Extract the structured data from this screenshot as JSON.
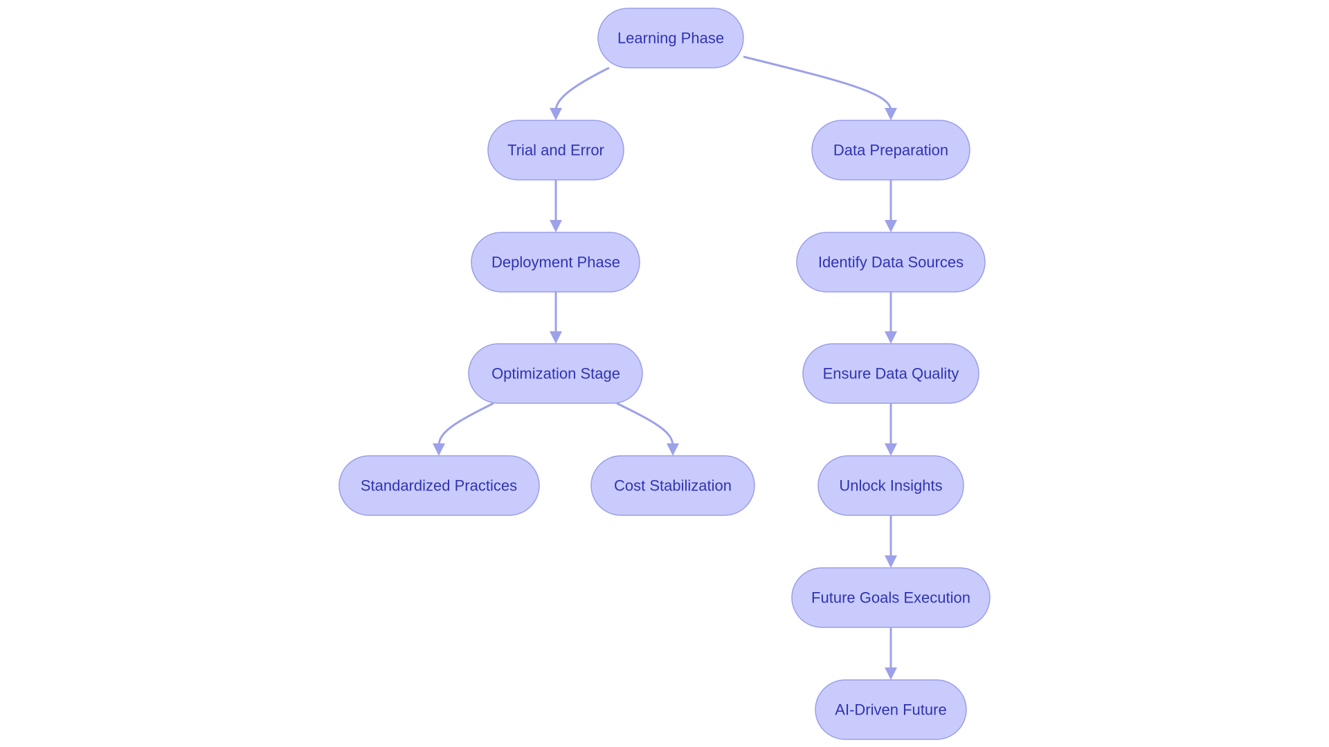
{
  "diagram": {
    "type": "flowchart",
    "colors": {
      "node_fill": "#c9cbfd",
      "node_border": "#9a9ee6",
      "text": "#3033b0",
      "edge": "#9da1e8"
    },
    "nodes": {
      "learning_phase": "Learning Phase",
      "trial_and_error": "Trial and Error",
      "data_preparation": "Data Preparation",
      "deployment_phase": "Deployment Phase",
      "identify_data_sources": "Identify Data Sources",
      "optimization_stage": "Optimization Stage",
      "ensure_data_quality": "Ensure Data Quality",
      "standardized_practices": "Standardized Practices",
      "cost_stabilization": "Cost Stabilization",
      "unlock_insights": "Unlock Insights",
      "future_goals_execution": "Future Goals Execution",
      "ai_driven_future": "AI-Driven Future"
    },
    "edges": [
      [
        "learning_phase",
        "trial_and_error"
      ],
      [
        "learning_phase",
        "data_preparation"
      ],
      [
        "trial_and_error",
        "deployment_phase"
      ],
      [
        "deployment_phase",
        "optimization_stage"
      ],
      [
        "optimization_stage",
        "standardized_practices"
      ],
      [
        "optimization_stage",
        "cost_stabilization"
      ],
      [
        "data_preparation",
        "identify_data_sources"
      ],
      [
        "identify_data_sources",
        "ensure_data_quality"
      ],
      [
        "ensure_data_quality",
        "unlock_insights"
      ],
      [
        "unlock_insights",
        "future_goals_execution"
      ],
      [
        "future_goals_execution",
        "ai_driven_future"
      ]
    ]
  }
}
